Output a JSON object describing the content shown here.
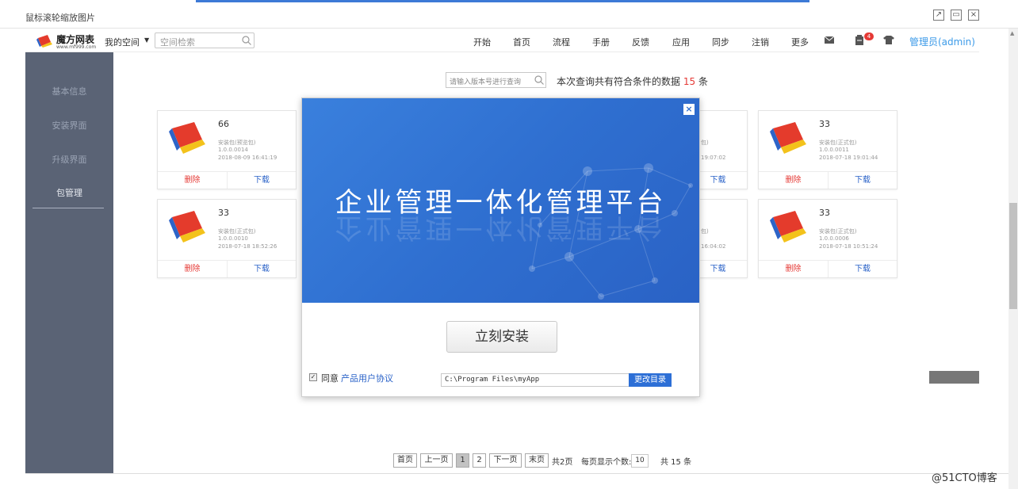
{
  "window": {
    "title": "鼠标滚轮缩放图片",
    "controls": [
      "popout-icon",
      "minimize-icon",
      "close-icon"
    ]
  },
  "header": {
    "logo_name": "魔方网表",
    "logo_sub": "www.mf999.com",
    "my_space": "我的空间",
    "search_placeholder": "空间检索",
    "nav": [
      "开始",
      "首页",
      "流程",
      "手册",
      "反馈",
      "应用",
      "同步",
      "注销",
      "更多"
    ],
    "icons": [
      "mail-icon",
      "clipboard-icon",
      "shirt-icon"
    ],
    "badge_count": "4",
    "admin": "管理员(admin)"
  },
  "sidebar": {
    "items": [
      "基本信息",
      "安装界面",
      "升级界面",
      "包管理"
    ],
    "active_index": 3
  },
  "query": {
    "placeholder": "请输入版本号进行查询",
    "result_prefix": "本次查询共有符合条件的数据",
    "result_count": "15",
    "result_suffix": "条"
  },
  "cards": [
    {
      "name": "66",
      "type": "安装包(预览包)",
      "version": "1.0.0.0014",
      "date": "2018-08-09 16:41:19",
      "delete": "删除",
      "download": "下载"
    },
    {
      "name": "33",
      "type": "安装包(正式包)",
      "version": "1.0.0.0011",
      "date": "2018-07-18 19:01:44",
      "delete": "删除",
      "download": "下载"
    },
    {
      "name": "33",
      "type": "安装包(正式包)",
      "version": "1.0.0.0010",
      "date": "2018-07-18 18:52:26",
      "delete": "删除",
      "download": "下载"
    },
    {
      "name": "33",
      "type": "安装包(正式包)",
      "version": "1.0.0.0006",
      "date": "2018-07-18 10:51:24",
      "delete": "删除",
      "download": "下载"
    }
  ],
  "partial_cards": [
    {
      "type_tail": "包)",
      "date_tail": "19:07:02",
      "download": "下载"
    },
    {
      "type_tail": "包)",
      "date_tail": "16:04:02",
      "download": "下载"
    }
  ],
  "modal": {
    "close": "×",
    "title": "企业管理一体化管理平台",
    "install_button": "立刻安装",
    "agree_text": "同意",
    "agree_link": "产品用户协议",
    "agree_checked": true,
    "install_path": "C:\\Program Files\\myApp",
    "change_dir": "更改目录"
  },
  "pager": {
    "first": "首页",
    "prev": "上一页",
    "pages": [
      "1",
      "2"
    ],
    "current": "1",
    "next": "下一页",
    "last": "末页",
    "total_pages": "共2页",
    "page_size_label": "每页显示个数:",
    "page_size": "10",
    "total": "共 15 条"
  },
  "watermark": "@51CTO博客",
  "colors": {
    "accent_blue": "#2f6fd0",
    "sidebar_bg": "#5a6375",
    "danger_red": "#e53935",
    "link_blue": "#2a62c8",
    "admin_blue": "#3b9ae8"
  }
}
